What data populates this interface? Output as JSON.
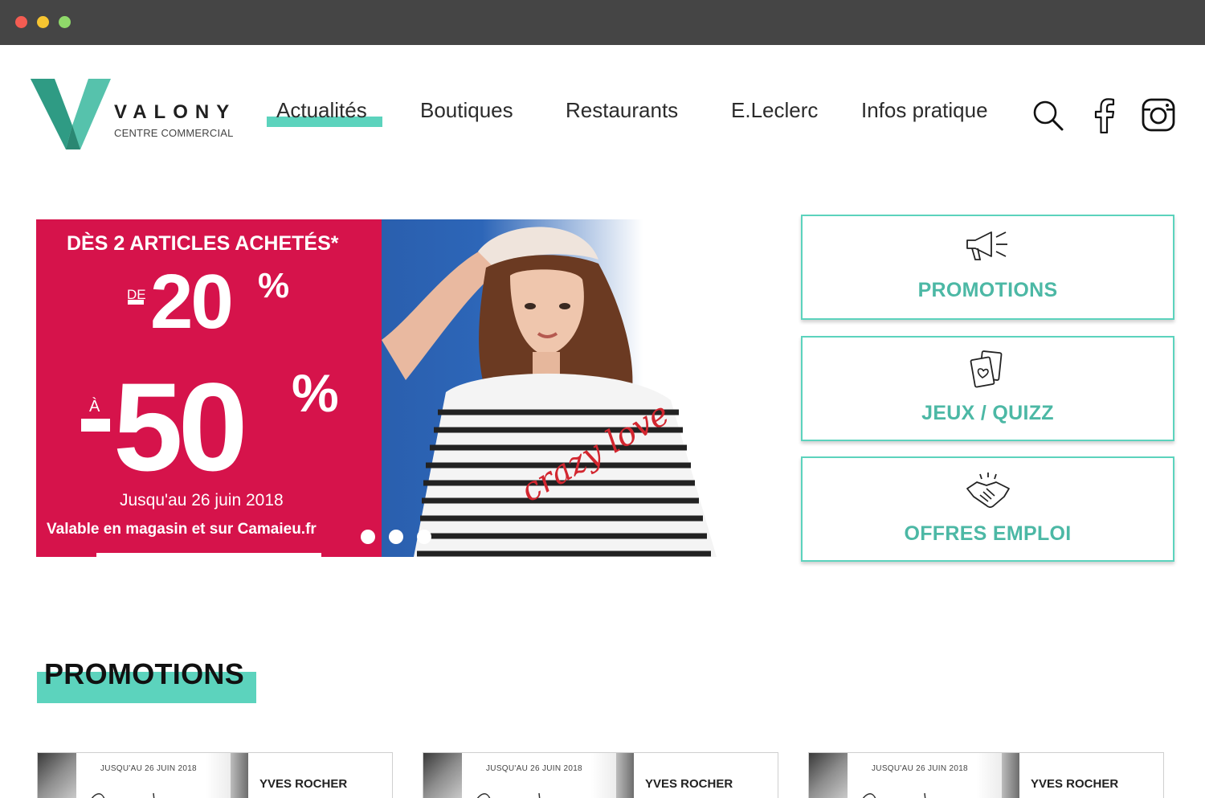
{
  "brand": {
    "name": "VALONY",
    "subtitle": "CENTRE COMMERCIAL",
    "accent_color": "#5cd3bd",
    "logo_color": "#3aa890"
  },
  "nav": {
    "items": [
      {
        "label": "Actualités",
        "active": true
      },
      {
        "label": "Boutiques",
        "active": false
      },
      {
        "label": "Restaurants",
        "active": false
      },
      {
        "label": "E.Leclerc",
        "active": false
      },
      {
        "label": "Infos pratique",
        "active": false
      }
    ],
    "icons": [
      "search-icon",
      "facebook-icon",
      "instagram-icon"
    ]
  },
  "hero": {
    "headline": "DÈS 2 ARTICLES ACHETÉS*",
    "from_prefix": "DE",
    "from_value": "20",
    "to_prefix": "À",
    "to_value": "50",
    "percent": "%",
    "date": "Jusqu'au 26 juin 2018",
    "validity": "Valable en magasin et sur Camaieu.fr",
    "banner_color": "#d6134b",
    "slide_count": 3,
    "active_slide": 1
  },
  "quick_links": [
    {
      "label": "PROMOTIONS",
      "icon": "megaphone-icon"
    },
    {
      "label": "JEUX / QUIZZ",
      "icon": "cards-icon"
    },
    {
      "label": "OFFRES EMPLOI",
      "icon": "handshake-icon"
    }
  ],
  "promotions_section": {
    "title": "PROMOTIONS",
    "cards": [
      {
        "date": "JUSQU'AU 26 JUIN 2018",
        "brand": "YVES ROCHER"
      },
      {
        "date": "JUSQU'AU 26 JUIN 2018",
        "brand": "YVES ROCHER"
      },
      {
        "date": "JUSQU'AU 26 JUIN 2018",
        "brand": "YVES ROCHER"
      }
    ]
  }
}
